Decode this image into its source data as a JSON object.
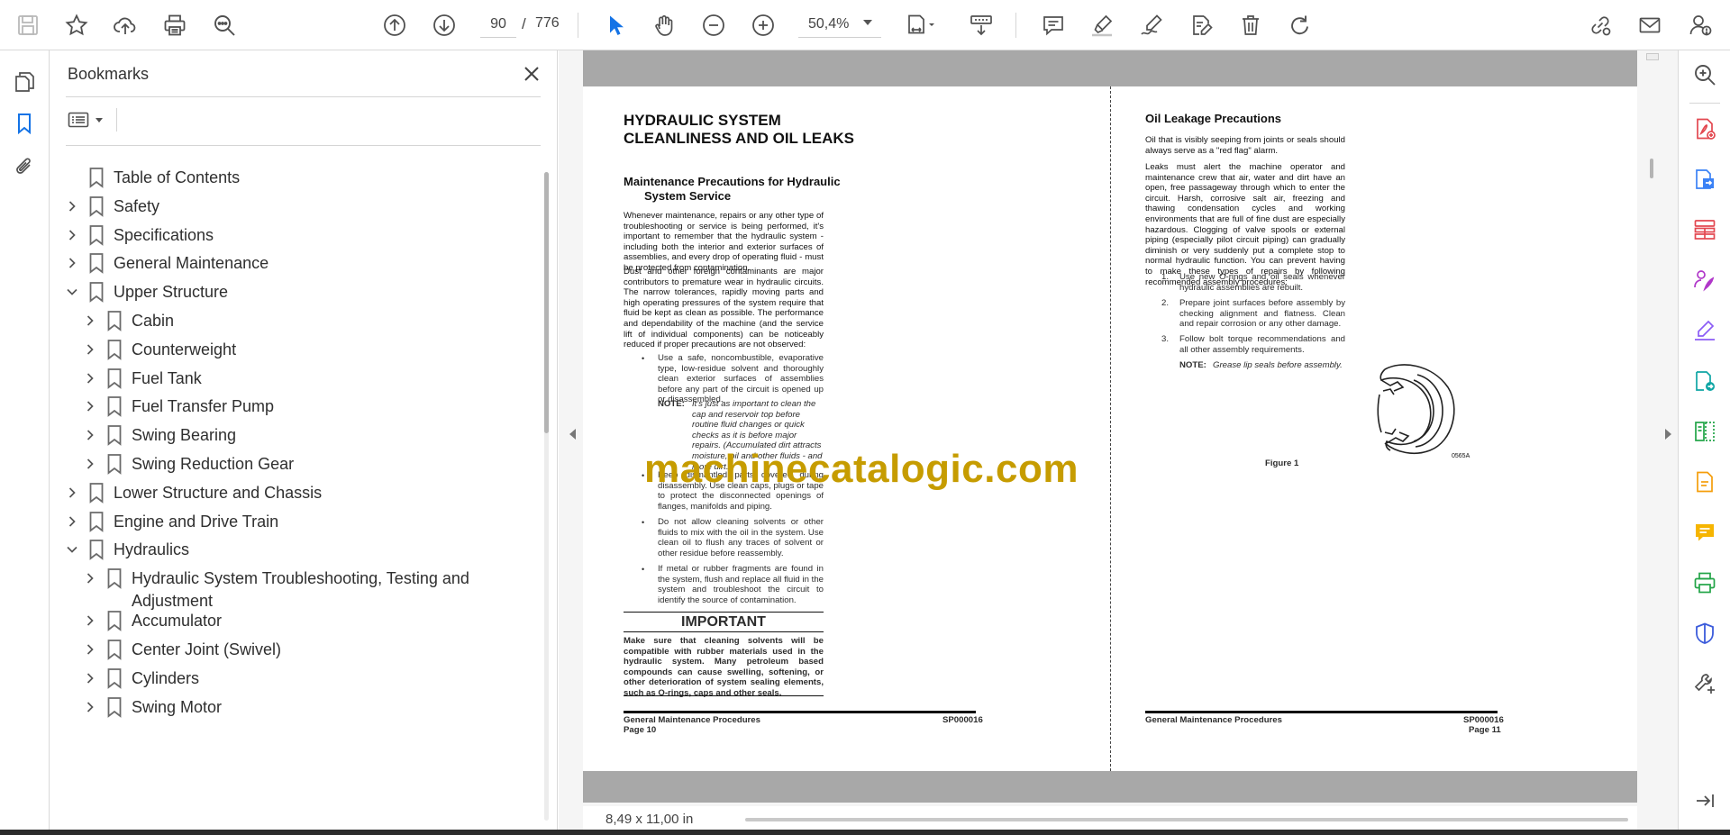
{
  "toolbar": {
    "current_page": "90",
    "page_separator": "/",
    "total_pages": "776",
    "zoom": "50,4%"
  },
  "bookmarks_panel": {
    "title": "Bookmarks",
    "items": [
      {
        "label": "Table of Contents",
        "level": 0,
        "expander": "none"
      },
      {
        "label": "Safety",
        "level": 0,
        "expander": "collapsed"
      },
      {
        "label": "Specifications",
        "level": 0,
        "expander": "collapsed"
      },
      {
        "label": "General Maintenance",
        "level": 0,
        "expander": "collapsed"
      },
      {
        "label": "Upper Structure",
        "level": 0,
        "expander": "expanded"
      },
      {
        "label": "Cabin",
        "level": 1,
        "expander": "collapsed"
      },
      {
        "label": "Counterweight",
        "level": 1,
        "expander": "collapsed"
      },
      {
        "label": "Fuel Tank",
        "level": 1,
        "expander": "collapsed"
      },
      {
        "label": "Fuel Transfer Pump",
        "level": 1,
        "expander": "collapsed"
      },
      {
        "label": "Swing Bearing",
        "level": 1,
        "expander": "collapsed"
      },
      {
        "label": "Swing Reduction Gear",
        "level": 1,
        "expander": "collapsed"
      },
      {
        "label": "Lower Structure and Chassis",
        "level": 0,
        "expander": "collapsed"
      },
      {
        "label": "Engine and Drive Train",
        "level": 0,
        "expander": "collapsed"
      },
      {
        "label": "Hydraulics",
        "level": 0,
        "expander": "expanded"
      },
      {
        "label": "Hydraulic System Troubleshooting, Testing and Adjustment",
        "level": 1,
        "expander": "collapsed"
      },
      {
        "label": "Accumulator",
        "level": 1,
        "expander": "collapsed"
      },
      {
        "label": "Center Joint (Swivel)",
        "level": 1,
        "expander": "collapsed"
      },
      {
        "label": "Cylinders",
        "level": 1,
        "expander": "collapsed"
      },
      {
        "label": "Swing Motor",
        "level": 1,
        "expander": "collapsed"
      }
    ]
  },
  "document": {
    "left_page": {
      "title_line1": "HYDRAULIC SYSTEM",
      "title_line2": "CLEANLINESS AND OIL LEAKS",
      "subtitle_line1": "Maintenance Precautions for Hydraulic",
      "subtitle_line2": "System Service",
      "para1": "Whenever maintenance, repairs or any other type of troubleshooting or service is being performed, it's important to remember that the hydraulic system - including both the interior and exterior surfaces of assemblies, and every drop of operating fluid - must be protected from contamination.",
      "para2": "Dust and other foreign contaminants are major contributors to premature wear in hydraulic circuits. The narrow tolerances, rapidly moving parts and high operating pressures of the system require that fluid be kept as clean as possible. The performance and dependability of the machine (and the service lift of individual components) can be noticeably reduced if proper precautions are not observed:",
      "bullet1": "Use a safe, noncombustible, evaporative type, low-residue solvent and thoroughly clean exterior surfaces of assemblies before any part of the circuit is opened up or disassembled.",
      "note_label": "NOTE:",
      "note_text": "It's just as important to clean the cap and reservoir top before routine fluid changes or quick checks as it is before major repairs. (Accumulated dirt attracts moisture, oil and other fluids - and more dirt.)",
      "bullet2": "Keep dismantled parts covered during disassembly. Use clean caps, plugs or tape to protect the disconnected openings of flanges, manifolds and piping.",
      "bullet3": "Do not allow cleaning solvents or other fluids to mix with the oil in the system. Use clean oil to flush any traces of solvent or other residue before reassembly.",
      "bullet4": "If metal or rubber fragments are found in the system, flush and replace all fluid in the system and troubleshoot the circuit to identify the source of contamination.",
      "important_title": "IMPORTANT",
      "important_text": "Make sure that cleaning solvents will be compatible with rubber materials used in the hydraulic system. Many petroleum based compounds can cause swelling, softening, or other deterioration of system sealing elements, such as O-rings, caps and other seals.",
      "footer_left": "General Maintenance Procedures",
      "footer_page": "Page 10",
      "footer_code": "SP000016"
    },
    "right_page": {
      "title": "Oil Leakage Precautions",
      "para1": "Oil that is visibly seeping from joints or seals should always serve as a \"red flag\" alarm.",
      "para2": "Leaks must alert the machine operator and maintenance crew that air, water and dirt have an open, free passageway through which to enter the circuit. Harsh, corrosive salt air, freezing and thawing condensation cycles and working environments that are full of fine dust are especially hazardous. Clogging of valve spools or external piping (especially pilot circuit piping) can gradually diminish or very suddenly put a complete stop to normal hydraulic function. You can prevent having to make these types of repairs by following recommended assembly procedures:",
      "step1_num": "1.",
      "step1": "Use new O-rings and oil seals whenever hydraulic assemblies are rebuilt.",
      "step2_num": "2.",
      "step2": "Prepare joint surfaces before assembly by checking alignment and flatness. Clean and repair corrosion or any other damage.",
      "step3_num": "3.",
      "step3": "Follow bolt torque recommendations and all other assembly requirements.",
      "note_label": "NOTE:",
      "note_text": "Grease lip seals before assembly.",
      "figure_caption": "Figure 1",
      "figure_code": "0565A",
      "footer_left": "General Maintenance Procedures",
      "footer_page": "Page 11",
      "footer_code": "SP000016"
    },
    "watermark": "machinecatalogic.com"
  },
  "status": {
    "page_size": "8,49 x 11,00 in"
  },
  "colors": {
    "accent_blue": "#1473e6",
    "icon_gray": "#505050",
    "watermark": "#c69c00"
  }
}
